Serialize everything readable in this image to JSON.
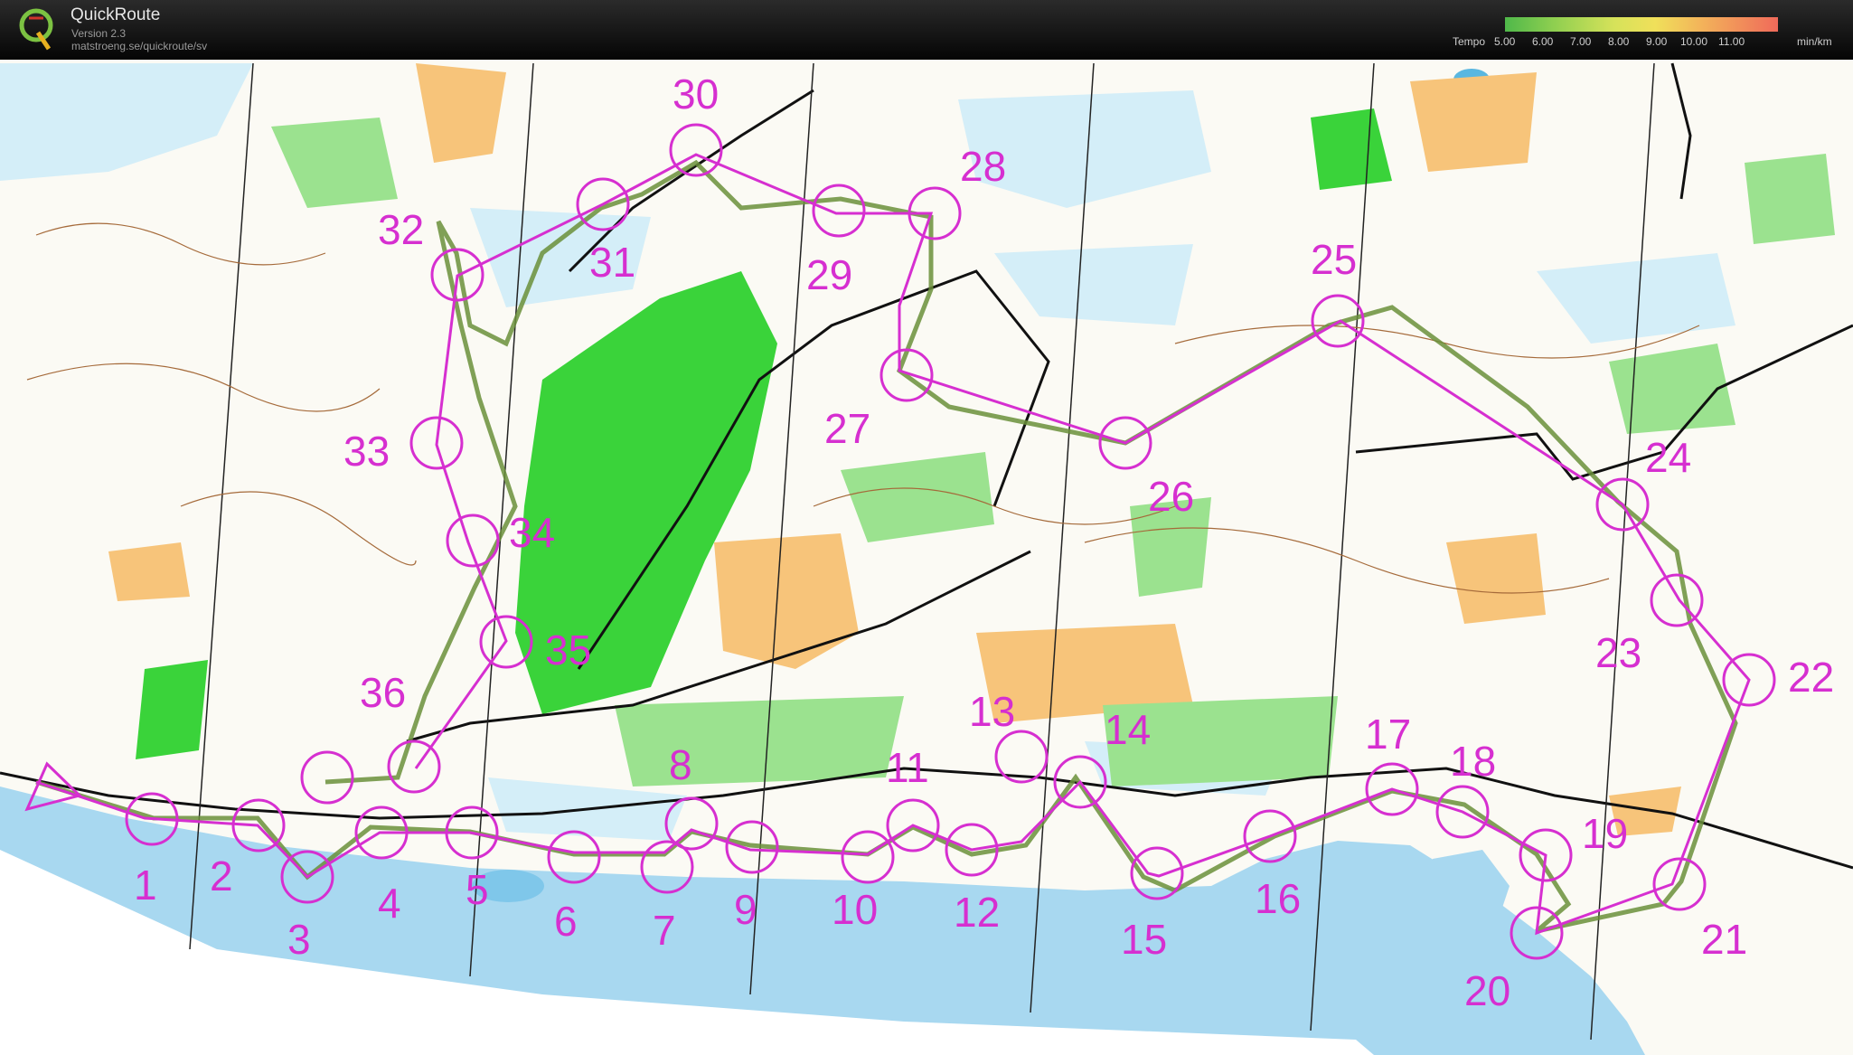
{
  "app": {
    "title": "QuickRoute",
    "version": "Version 2.3",
    "url": "matstroeng.se/quickroute/sv"
  },
  "tempo_legend": {
    "label": "Tempo",
    "ticks": [
      "5.00",
      "6.00",
      "7.00",
      "8.00",
      "9.00",
      "10.00",
      "11.00"
    ],
    "unit": "min/km",
    "colors": [
      "#4fb84a",
      "#8fcf50",
      "#d6e25a",
      "#f0e05a",
      "#f3b35a",
      "#ef6a5a"
    ]
  },
  "map": {
    "course_color": "#d62fd0",
    "route_color": "#6a8f3a",
    "water_color": "#a8d8f0",
    "forest_color": "#3ad33a",
    "open_color": "#f7c47a",
    "controls": [
      "1",
      "2",
      "3",
      "4",
      "5",
      "6",
      "7",
      "8",
      "9",
      "10",
      "11",
      "12",
      "13",
      "14",
      "15",
      "16",
      "17",
      "18",
      "19",
      "20",
      "21",
      "22",
      "23",
      "24",
      "25",
      "26",
      "27",
      "28",
      "29",
      "30",
      "31",
      "32",
      "33",
      "34",
      "35",
      "36"
    ],
    "start_icon": "start-triangle-icon"
  }
}
